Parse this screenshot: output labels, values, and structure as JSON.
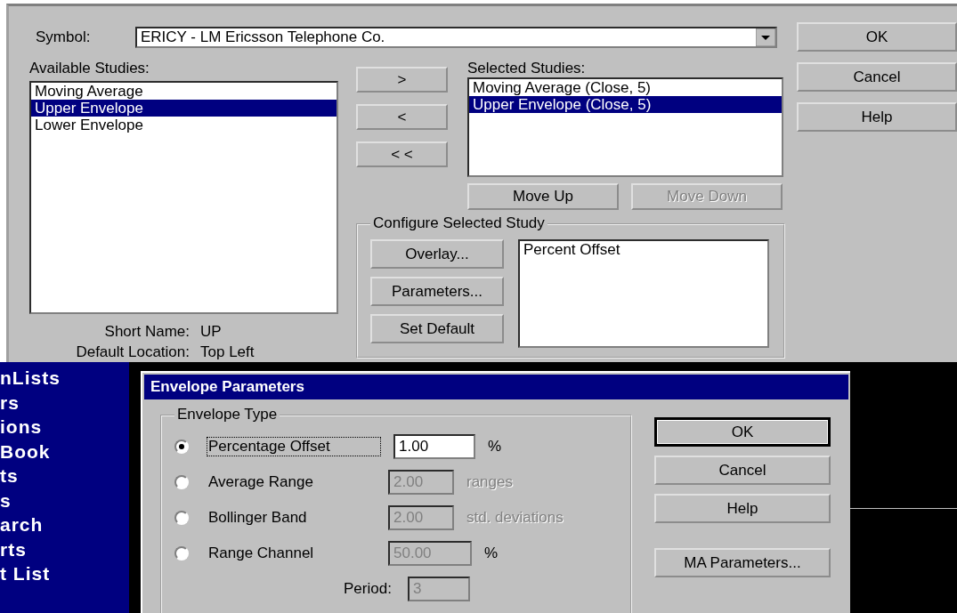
{
  "studies_dialog": {
    "symbol_label": "Symbol:",
    "symbol_value": "ERICY - LM Ericsson Telephone Co.",
    "available_label": "Available Studies:",
    "available": [
      {
        "label": "Moving Average",
        "selected": false
      },
      {
        "label": "Upper Envelope",
        "selected": true
      },
      {
        "label": "Lower Envelope",
        "selected": false
      }
    ],
    "transfer_buttons": [
      ">",
      "<",
      "< <"
    ],
    "selected_label": "Selected Studies:",
    "selected_studies": [
      {
        "label": "Moving Average (Close, 5)",
        "selected": false
      },
      {
        "label": "Upper Envelope (Close, 5)",
        "selected": true
      }
    ],
    "move_buttons": [
      {
        "label": "Move Up",
        "disabled": false
      },
      {
        "label": "Move Down",
        "disabled": true
      }
    ],
    "configure": {
      "title": "Configure Selected Study",
      "buttons": [
        "Overlay...",
        "Parameters...",
        "Set Default"
      ],
      "items": [
        "Percent Offset"
      ]
    },
    "short_name_label": "Short Name:",
    "short_name": "UP",
    "location_label": "Default Location:",
    "location": "Top Left",
    "buttons": [
      "OK",
      "Cancel",
      "Help"
    ]
  },
  "sidebar": {
    "items": [
      "nLists",
      "rs",
      "ions",
      "Book",
      "ts",
      "s",
      "arch",
      "rts",
      "t List"
    ]
  },
  "envelope_dialog": {
    "title": "Envelope Parameters",
    "group_title": "Envelope Type",
    "options": [
      {
        "label": "Percentage Offset",
        "selected": true,
        "focused": true,
        "value": "1.00",
        "unit": "%",
        "disabled": false
      },
      {
        "label": "Average Range",
        "selected": false,
        "focused": false,
        "value": "2.00",
        "unit": "ranges",
        "disabled": true
      },
      {
        "label": "Bollinger Band",
        "selected": false,
        "focused": false,
        "value": "2.00",
        "unit": "std. deviations",
        "disabled": true
      },
      {
        "label": "Range Channel",
        "selected": false,
        "focused": false,
        "value": "50.00",
        "unit": "%",
        "disabled": true
      }
    ],
    "period": {
      "label": "Period:",
      "value": "3",
      "disabled": true
    },
    "buttons": [
      {
        "label": "OK",
        "default": true
      },
      {
        "label": "Cancel",
        "default": false
      },
      {
        "label": "Help",
        "default": false
      },
      {
        "label": "MA Parameters...",
        "default": false
      }
    ]
  }
}
